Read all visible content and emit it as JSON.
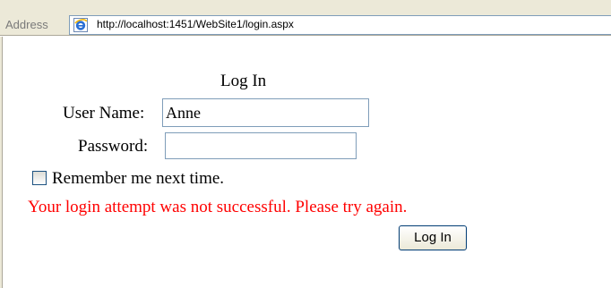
{
  "address_bar": {
    "label": "Address",
    "url": "http://localhost:1451/WebSite1/login.aspx"
  },
  "login": {
    "title": "Log In",
    "username_label": "User Name:",
    "username_value": "Anne",
    "password_label": "Password:",
    "password_value": "",
    "remember_label": "Remember me next time.",
    "remember_checked": false,
    "error_message": "Your login attempt was not successful. Please try again.",
    "submit_label": "Log In"
  },
  "colors": {
    "error": "#ff0000",
    "chrome": "#ece9d8",
    "input_border": "#7f9db9"
  },
  "icons": {
    "page_icon": "internet-explorer-icon"
  }
}
